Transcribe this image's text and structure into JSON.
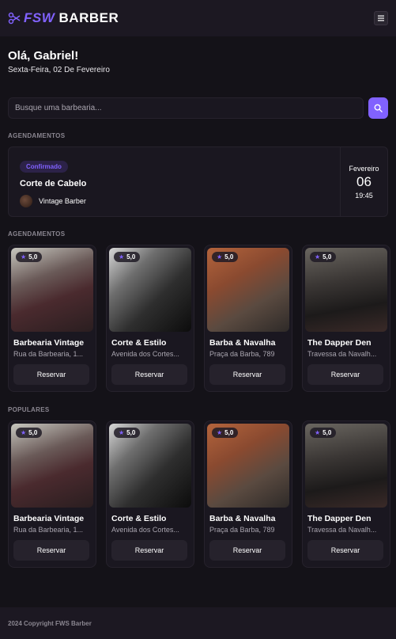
{
  "header": {
    "logo_accent": "FSW",
    "logo_text": "BARBER",
    "menu_icon": "menu-icon"
  },
  "greeting": {
    "title": "Olá, Gabriel!",
    "date": "Sexta-Feira, 02 De Fevereiro"
  },
  "search": {
    "placeholder": "Busque uma barbearia...",
    "icon": "search-icon"
  },
  "bookings_section": {
    "title": "AGENDAMENTOS",
    "booking": {
      "status": "Confirmado",
      "service": "Corte de Cabelo",
      "shop": "Vintage Barber",
      "month": "Fevereiro",
      "day": "06",
      "time": "19:45"
    }
  },
  "recommended_section": {
    "title": "AGENDAMENTOS",
    "cards": [
      {
        "rating": "5,0",
        "name": "Barbearia Vintage",
        "address": "Rua da Barbearia, 1...",
        "button": "Reservar"
      },
      {
        "rating": "5,0",
        "name": "Corte & Estilo",
        "address": "Avenida dos Cortes...",
        "button": "Reservar"
      },
      {
        "rating": "5,0",
        "name": "Barba & Navalha",
        "address": "Praça da Barba, 789",
        "button": "Reservar"
      },
      {
        "rating": "5,0",
        "name": "The Dapper Den",
        "address": "Travessa da Navalh...",
        "button": "Reservar"
      }
    ]
  },
  "popular_section": {
    "title": "POPULARES",
    "cards": [
      {
        "rating": "5,0",
        "name": "Barbearia Vintage",
        "address": "Rua da Barbearia, 1...",
        "button": "Reservar"
      },
      {
        "rating": "5,0",
        "name": "Corte & Estilo",
        "address": "Avenida dos Cortes...",
        "button": "Reservar"
      },
      {
        "rating": "5,0",
        "name": "Barba & Navalha",
        "address": "Praça da Barba, 789",
        "button": "Reservar"
      },
      {
        "rating": "5,0",
        "name": "The Dapper Den",
        "address": "Travessa da Navalh...",
        "button": "Reservar"
      }
    ]
  },
  "footer": {
    "text": "2024 Copyright FWS Barber"
  },
  "colors": {
    "accent": "#8162ff",
    "background": "#141218",
    "card": "#1a1720"
  }
}
